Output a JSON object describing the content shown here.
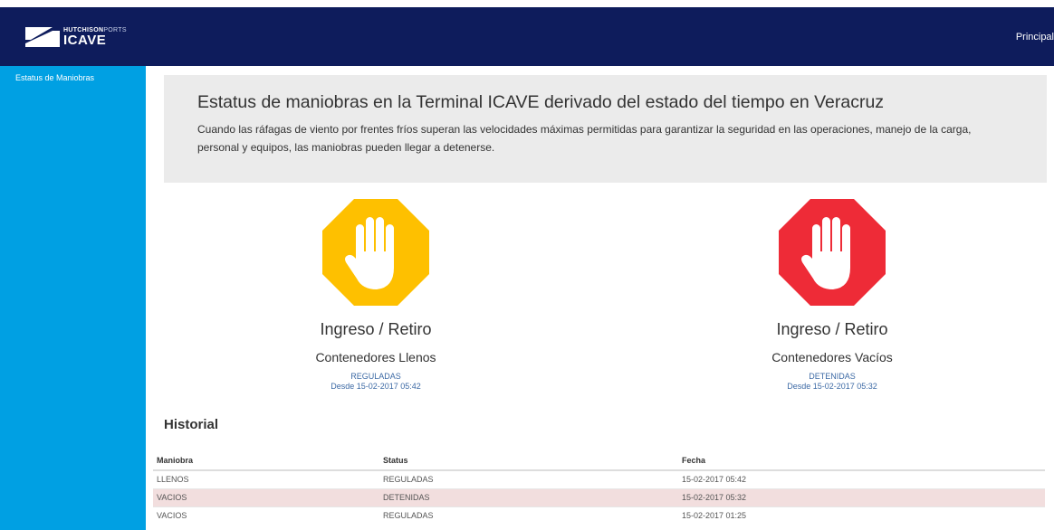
{
  "header": {
    "brand_top_bold": "HUTCHISON",
    "brand_top_light": "PORTS",
    "brand_main": "ICAVE",
    "nav_principal": "Principal"
  },
  "sidebar": {
    "items": [
      {
        "label": "Estatus de Maniobras"
      }
    ]
  },
  "jumbotron": {
    "title": "Estatus de maniobras en la Terminal ICAVE derivado del estado del tiempo en Veracruz",
    "text": "Cuando las ráfagas de viento por frentes fríos superan las velocidades máximas permitidas para garantizar la seguridad en las operaciones, manejo de la carga, personal y equipos, las maniobras pueden llegar a detenerse."
  },
  "cards": [
    {
      "icon": "stop-hand-icon",
      "color": "#fec000",
      "title": "Ingreso / Retiro",
      "subtitle": "Contenedores Llenos",
      "state": "REGULADAS",
      "since": "Desde 15-02-2017 05:42"
    },
    {
      "icon": "stop-hand-icon",
      "color": "#ee2b37",
      "title": "Ingreso / Retiro",
      "subtitle": "Contenedores Vacíos",
      "state": "DETENIDAS",
      "since": "Desde 15-02-2017 05:32"
    }
  ],
  "historial": {
    "title": "Historial",
    "columns": [
      "Maniobra",
      "Status",
      "Fecha"
    ],
    "rows": [
      {
        "maniobra": "LLENOS",
        "status": "REGULADAS",
        "fecha": "15-02-2017 05:42"
      },
      {
        "maniobra": "VACIOS",
        "status": "DETENIDAS",
        "fecha": "15-02-2017 05:32"
      },
      {
        "maniobra": "VACIOS",
        "status": "REGULADAS",
        "fecha": "15-02-2017 01:25"
      }
    ]
  },
  "colors": {
    "navbar": "#0e1c5c",
    "sidebar": "#00a0e3",
    "regulated": "#fec000",
    "stopped": "#ee2b37",
    "stopped_row": "#f2dede"
  }
}
